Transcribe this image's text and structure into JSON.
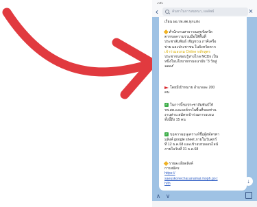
{
  "status_bar": {
    "label": "•กลับ"
  },
  "search": {
    "placeholder": "ค้นหาในการสนทนา, ผลลัพธ์"
  },
  "message": {
    "greeting": "เรียน ผอ.รพ.สต.ทุกแห่ง",
    "para1_lines": [
      "สำนักงานสาธารณสุขจังหวัด",
      "ตากขอความร่วมมือให้พื้นที่",
      "ประชาสัมพันธ์ เชิญชวน ภาคีเครือ",
      "ข่าย และประชาชน ในจังหวัดตาก",
      "เข้าร่วมอบรม Online หลักสูตร",
      "ประชาชนชอบรู้ห่างไกล NCDs เป็น",
      "หนึ่งในนโยบายกรมอนามัย \"3 วัยสู่",
      "ฉลอง\""
    ],
    "target_line": "โดยมีเป้าหมาย อำเภอละ 200",
    "target_unit": "คน",
    "para2_lines": [
      "ในการนี้ขอประชาสัมพันธ์ให้",
      "รพ.สต.และองค์กรในพื้นที่ของท่าน",
      "งานท่าน สมัครเข้าร่วมการอบรม",
      "ทั้งนี้ถึง 15 คน"
    ],
    "para3_lines": [
      "ขอความอนุเคราะห์ชื่อผู้สมัครตา",
      "มลิงค์ google sheet ภายในวันศุกร์",
      "ที่ 12 ธ.ค.68 และเข้าอบรมออนไลน์",
      "ภายในวันที่ 31 ธ.ค.68"
    ],
    "para4_lines": [
      "รายละเอียดลิงค์",
      "การสมัคร"
    ],
    "link_lines": [
      "https://",
      "saeuskonechai.anamai.moph.go.t",
      "h/th"
    ]
  },
  "colors": {
    "chat_bg": "#9fc2e4",
    "arrow": "#e13a3f",
    "highlight": "#d8ae00",
    "link": "#2f5ec4"
  },
  "icons": [
    "search-icon",
    "back-chevron-icon",
    "close-icon",
    "diamond-icon",
    "red-flag-icon",
    "checkmark-icon",
    "scroll-down-icon",
    "share-icon",
    "nav-up-icon",
    "nav-down-icon"
  ]
}
